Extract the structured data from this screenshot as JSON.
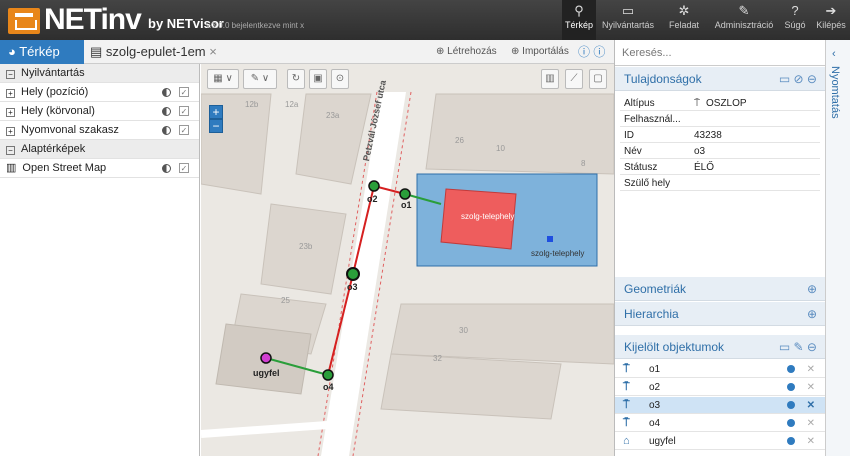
{
  "app": {
    "brand": "NETinv",
    "by": "by NETvisor",
    "version": "v.3.0.0 bejelentkezve mint x"
  },
  "nav": [
    {
      "icon": "map-pin-icon",
      "glyph": "⚲",
      "label": "Térkép"
    },
    {
      "icon": "inbox-icon",
      "glyph": "▭",
      "label": "Nyilvántartás"
    },
    {
      "icon": "gear-icon",
      "glyph": "✲",
      "label": "Feladat"
    },
    {
      "icon": "wrench-icon",
      "glyph": "✎",
      "label": "Adminisztráció"
    },
    {
      "icon": "help-icon",
      "glyph": "?",
      "label": "Súgó"
    },
    {
      "icon": "logout-icon",
      "glyph": "➔",
      "label": "Kilépés"
    }
  ],
  "tabs": {
    "map": "Térkép",
    "doc": "szolg-epulet-1em",
    "close": "×",
    "create": "Létrehozás",
    "import": "Importálás"
  },
  "layers": {
    "header1": "Nyilvántartás",
    "items": [
      "Hely (pozíció)",
      "Hely (körvonal)",
      "Nyomvonal szakasz"
    ],
    "header2": "Alaptérképek",
    "base": "Open Street Map"
  },
  "map": {
    "street": "Petzvál József utca",
    "labels": {
      "blue": "szolg-telephely",
      "red": "szolg-telephely",
      "n26": "26",
      "n10": "10",
      "n8": "8",
      "n12b": "12b",
      "n12a": "12a",
      "n23a": "23a",
      "n23b": "23b",
      "n25": "25",
      "n30": "30",
      "n32": "32"
    },
    "nodes": {
      "o1": "o1",
      "o2": "o2",
      "o3": "o3",
      "o4": "o4",
      "ugyfel": "ugyfel"
    },
    "zoom_in": "+",
    "zoom_out": "−"
  },
  "right": {
    "search_placeholder": "Keresés...",
    "props_title": "Tulajdonságok",
    "props": [
      {
        "k": "Altípus",
        "v": "OSZLOP"
      },
      {
        "k": "Felhasznál...",
        "v": ""
      },
      {
        "k": "ID",
        "v": "43238"
      },
      {
        "k": "Név",
        "v": "o3"
      },
      {
        "k": "Státusz",
        "v": "ÉLŐ"
      },
      {
        "k": "Szülő hely",
        "v": ""
      }
    ],
    "geom": "Geometriák",
    "hier": "Hierarchia",
    "sel_title": "Kijelölt objektumok",
    "objects": [
      "o1",
      "o2",
      "o3",
      "o4",
      "ugyfel"
    ]
  },
  "sidebar": {
    "label": "Nyomtatás"
  }
}
